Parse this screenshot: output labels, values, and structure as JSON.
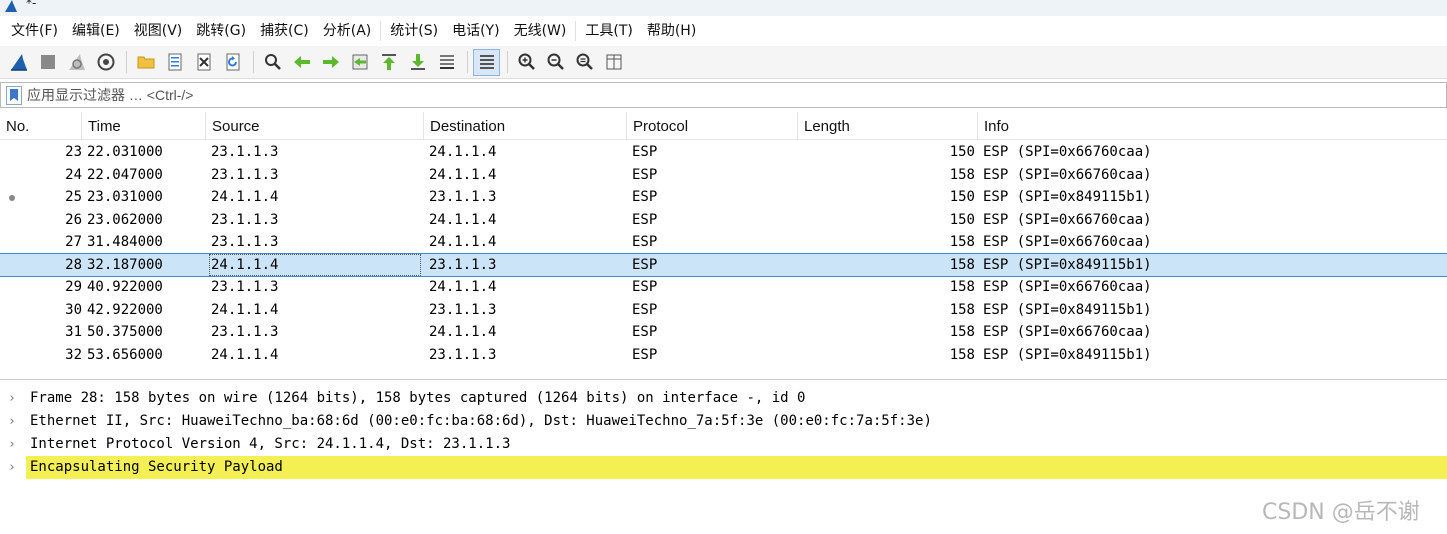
{
  "window": {
    "title": "*-"
  },
  "menubar": {
    "items": [
      "文件(F)",
      "编辑(E)",
      "视图(V)",
      "跳转(G)",
      "捕获(C)",
      "分析(A)",
      "统计(S)",
      "电话(Y)",
      "无线(W)",
      "工具(T)",
      "帮助(H)"
    ]
  },
  "toolbar": {
    "buttons": [
      "shark-fin-start-icon",
      "stop-square-icon",
      "restart-fin-icon",
      "capture-options-gear-icon",
      "open-folder-icon",
      "save-file-icon",
      "close-file-icon",
      "reload-file-icon",
      "find-magnifier-icon",
      "go-back-arrow-icon",
      "go-forward-arrow-icon",
      "go-to-packet-icon",
      "go-first-packet-icon",
      "go-last-packet-icon",
      "auto-scroll-icon",
      "colorize-list-icon",
      "zoom-in-icon",
      "zoom-out-icon",
      "zoom-normal-icon",
      "resize-columns-icon"
    ]
  },
  "filter": {
    "placeholder": "应用显示过滤器 … <Ctrl-/>",
    "value": ""
  },
  "packet_list": {
    "columns": [
      "No.",
      "Time",
      "Source",
      "Destination",
      "Protocol",
      "Length",
      "Info"
    ],
    "rows": [
      {
        "no": "23",
        "time": "22.031000",
        "src": "23.1.1.3",
        "dst": "24.1.1.4",
        "proto": "ESP",
        "len": "150",
        "info": "ESP (SPI=0x66760caa)"
      },
      {
        "no": "24",
        "time": "22.047000",
        "src": "23.1.1.3",
        "dst": "24.1.1.4",
        "proto": "ESP",
        "len": "158",
        "info": "ESP (SPI=0x66760caa)"
      },
      {
        "no": "25",
        "time": "23.031000",
        "src": "24.1.1.4",
        "dst": "23.1.1.3",
        "proto": "ESP",
        "len": "150",
        "info": "ESP (SPI=0x849115b1)"
      },
      {
        "no": "26",
        "time": "23.062000",
        "src": "23.1.1.3",
        "dst": "24.1.1.4",
        "proto": "ESP",
        "len": "150",
        "info": "ESP (SPI=0x66760caa)"
      },
      {
        "no": "27",
        "time": "31.484000",
        "src": "23.1.1.3",
        "dst": "24.1.1.4",
        "proto": "ESP",
        "len": "158",
        "info": "ESP (SPI=0x66760caa)"
      },
      {
        "no": "28",
        "time": "32.187000",
        "src": "24.1.1.4",
        "dst": "23.1.1.3",
        "proto": "ESP",
        "len": "158",
        "info": "ESP (SPI=0x849115b1)"
      },
      {
        "no": "29",
        "time": "40.922000",
        "src": "23.1.1.3",
        "dst": "24.1.1.4",
        "proto": "ESP",
        "len": "158",
        "info": "ESP (SPI=0x66760caa)"
      },
      {
        "no": "30",
        "time": "42.922000",
        "src": "24.1.1.4",
        "dst": "23.1.1.3",
        "proto": "ESP",
        "len": "158",
        "info": "ESP (SPI=0x849115b1)"
      },
      {
        "no": "31",
        "time": "50.375000",
        "src": "23.1.1.3",
        "dst": "24.1.1.4",
        "proto": "ESP",
        "len": "158",
        "info": "ESP (SPI=0x66760caa)"
      },
      {
        "no": "32",
        "time": "53.656000",
        "src": "24.1.1.4",
        "dst": "23.1.1.3",
        "proto": "ESP",
        "len": "158",
        "info": "ESP (SPI=0x849115b1)"
      }
    ],
    "selected_no": "28",
    "related_marker_no": "25"
  },
  "details": {
    "rows": [
      {
        "text": "Frame 28: 158 bytes on wire (1264 bits), 158 bytes captured (1264 bits) on interface -, id 0",
        "highlight": false
      },
      {
        "text": "Ethernet II, Src: HuaweiTechno_ba:68:6d (00:e0:fc:ba:68:6d), Dst: HuaweiTechno_7a:5f:3e (00:e0:fc:7a:5f:3e)",
        "highlight": false
      },
      {
        "text": "Internet Protocol Version 4, Src: 24.1.1.4, Dst: 23.1.1.3",
        "highlight": false
      },
      {
        "text": "Encapsulating Security Payload",
        "highlight": true
      }
    ],
    "expander_glyph": "›"
  },
  "watermark": "CSDN @岳不谢",
  "colors": {
    "selected_row": "#cce4f7",
    "selected_outline": "#3d8bd6",
    "highlight_yellow": "#f4ef52",
    "shark_blue": "#1f5fb0"
  }
}
